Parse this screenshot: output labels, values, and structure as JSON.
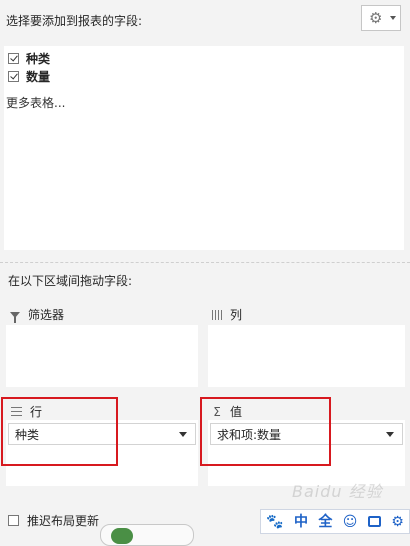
{
  "header": {
    "title": "选择要添加到报表的字段:",
    "settings_icon": "gear-icon"
  },
  "fields": [
    {
      "label": "种类",
      "checked": true
    },
    {
      "label": "数量",
      "checked": true
    }
  ],
  "more_tables": "更多表格...",
  "drag_title": "在以下区域间拖动字段:",
  "areas": {
    "filters": {
      "label": "筛选器",
      "icon": "filter-icon"
    },
    "columns": {
      "label": "列",
      "icon": "columns-icon"
    },
    "rows": {
      "label": "行",
      "icon": "rows-icon",
      "item": "种类"
    },
    "values": {
      "label": "值",
      "icon": "sigma-icon",
      "item": "求和项:数量"
    }
  },
  "footer": {
    "defer_label": "推迟布局更新",
    "defer_checked": false
  },
  "toolbar": {
    "items": [
      "paw-icon",
      "中",
      "全",
      "smiley-icon",
      "picture-icon",
      "gear-icon"
    ]
  },
  "watermark": "Baidu 经验",
  "colors": {
    "highlight": "#d7191f",
    "toolbar_accent": "#1e62c7"
  }
}
